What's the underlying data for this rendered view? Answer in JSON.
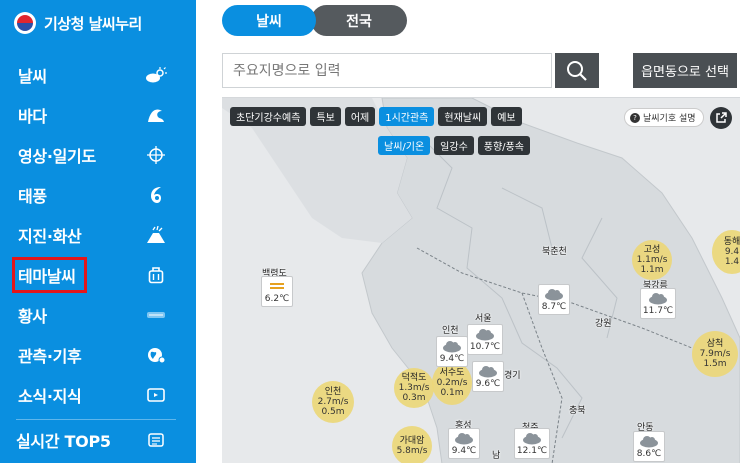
{
  "brand": {
    "title": "기상청 날씨누리"
  },
  "sidebar": {
    "items": [
      {
        "label": "날씨",
        "icon": "cloud-sun-icon"
      },
      {
        "label": "바다",
        "icon": "wave-icon"
      },
      {
        "label": "영상·일기도",
        "icon": "globe-crosshair-icon"
      },
      {
        "label": "태풍",
        "icon": "typhoon-icon"
      },
      {
        "label": "지진·화산",
        "icon": "volcano-icon"
      },
      {
        "label": "테마날씨",
        "icon": "briefcase-icon"
      },
      {
        "label": "황사",
        "icon": "dust-icon"
      },
      {
        "label": "관측·기후",
        "icon": "earth-icon"
      },
      {
        "label": "소식·지식",
        "icon": "monitor-icon"
      },
      {
        "label": "실시간 TOP5",
        "icon": "list-icon"
      }
    ]
  },
  "tabs": [
    {
      "label": "날씨"
    },
    {
      "label": "전국"
    }
  ],
  "search": {
    "placeholder": "주요지명으로 입력",
    "region_button": "읍면동으로 선택"
  },
  "map": {
    "chips_row1": [
      "초단기강수예측",
      "특보",
      "어제",
      "1시간관측",
      "현재날씨",
      "예보"
    ],
    "chips_row2": [
      "날씨/기온",
      "일강수",
      "풍향/풍속"
    ],
    "legend_label": "날씨기호 설명",
    "places": [
      "백령도",
      "북춘천",
      "북강릉",
      "강원",
      "인천",
      "서울",
      "경기",
      "충북",
      "홍성",
      "청주",
      "안동",
      "남"
    ],
    "wind": [
      {
        "name": "고성",
        "speed": "1.1m/s",
        "gust": "1.1m"
      },
      {
        "name": "동해",
        "speed": "9.4",
        "gust": "1.4"
      },
      {
        "name": "삼척",
        "speed": "7.9m/s",
        "gust": "1.5m"
      },
      {
        "name": "인천",
        "speed": "2.7m/s",
        "gust": "0.5m"
      },
      {
        "name": "덕적도",
        "speed": "1.3m/s",
        "gust": "0.3m"
      },
      {
        "name": "서수도",
        "speed": "0.2m/s",
        "gust": "0.1m"
      },
      {
        "name": "가대암",
        "speed": "5.8m/s",
        "gust": ""
      }
    ],
    "stations": [
      {
        "temp": "6.2℃"
      },
      {
        "temp": "8.7℃"
      },
      {
        "temp": "11.7℃"
      },
      {
        "temp": "10.7℃"
      },
      {
        "temp": "9.4℃"
      },
      {
        "temp": "9.6℃"
      },
      {
        "temp": "9.4℃"
      },
      {
        "temp": "12.1℃"
      },
      {
        "temp": "8.6℃"
      }
    ]
  }
}
